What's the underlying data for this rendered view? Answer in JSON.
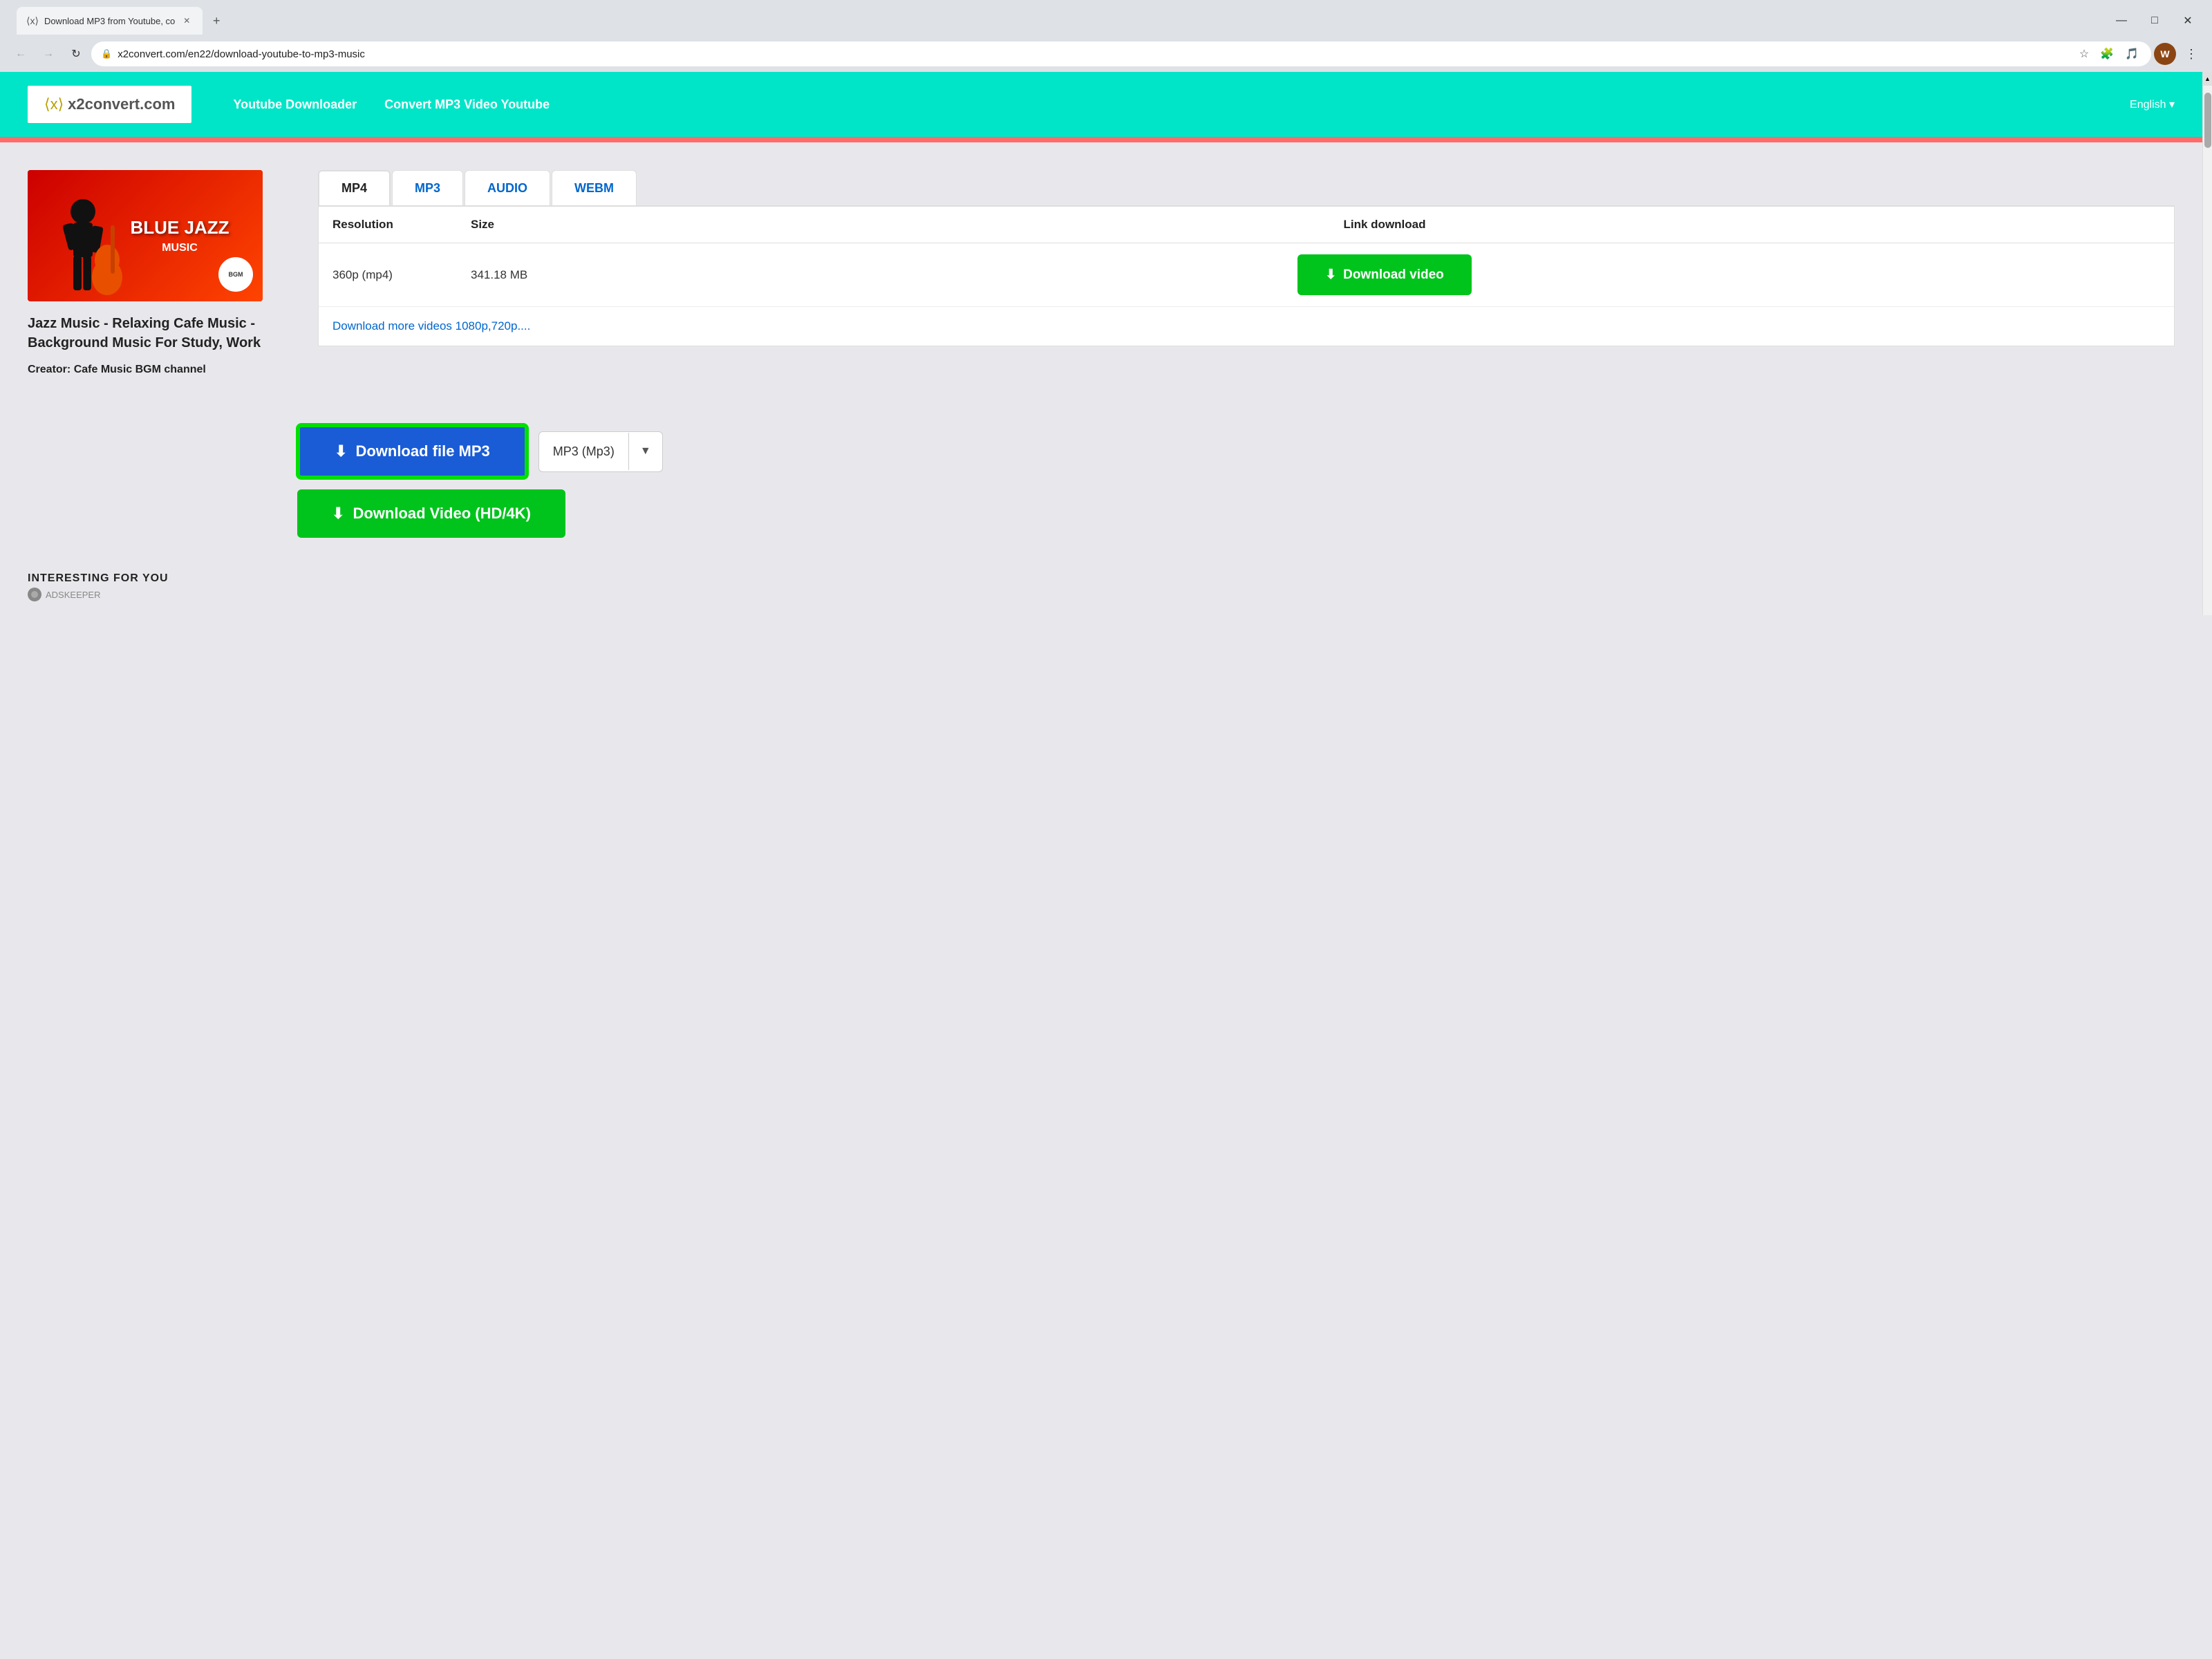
{
  "browser": {
    "tab_title": "Download MP3 from Youtube, co",
    "tab_icon": "⟨x⟩",
    "url": "x2convert.com/en22/download-youtube-to-mp3-music",
    "window_controls": {
      "minimize": "—",
      "maximize": "□",
      "close": "✕"
    },
    "nav": {
      "back": "←",
      "forward": "→",
      "refresh": "↻"
    }
  },
  "site": {
    "logo_icon": "⟨x⟩",
    "logo_text": "x2convert.com",
    "nav_links": [
      "Youtube Downloader",
      "Convert MP3 Video Youtube"
    ],
    "lang": "English ▾"
  },
  "video": {
    "thumbnail_title": "BLUE JAZZ",
    "thumbnail_subtitle": "MUSIC",
    "bgm_text": "BGM",
    "title": "Jazz Music - Relaxing Cafe Music - Background Music For Study, Work",
    "creator_label": "Creator:",
    "creator_name": "Cafe Music BGM channel"
  },
  "format_tabs": [
    "MP4",
    "MP3",
    "AUDIO",
    "WEBM"
  ],
  "table": {
    "headers": [
      "Resolution",
      "Size",
      "Link download"
    ],
    "rows": [
      {
        "resolution": "360p (mp4)",
        "size": "341.18 MB",
        "btn_label": "Download video"
      }
    ],
    "more_link": "Download more videos 1080p,720p...."
  },
  "download_buttons": {
    "mp3_btn": "Download file MP3",
    "format_label": "MP3 (Mp3)",
    "hd_btn": "Download Video (HD/4K)",
    "download_icon": "⬇"
  },
  "interesting": {
    "label": "INTERESTING FOR YOU",
    "adskeeper": "ADSKEEPER"
  }
}
